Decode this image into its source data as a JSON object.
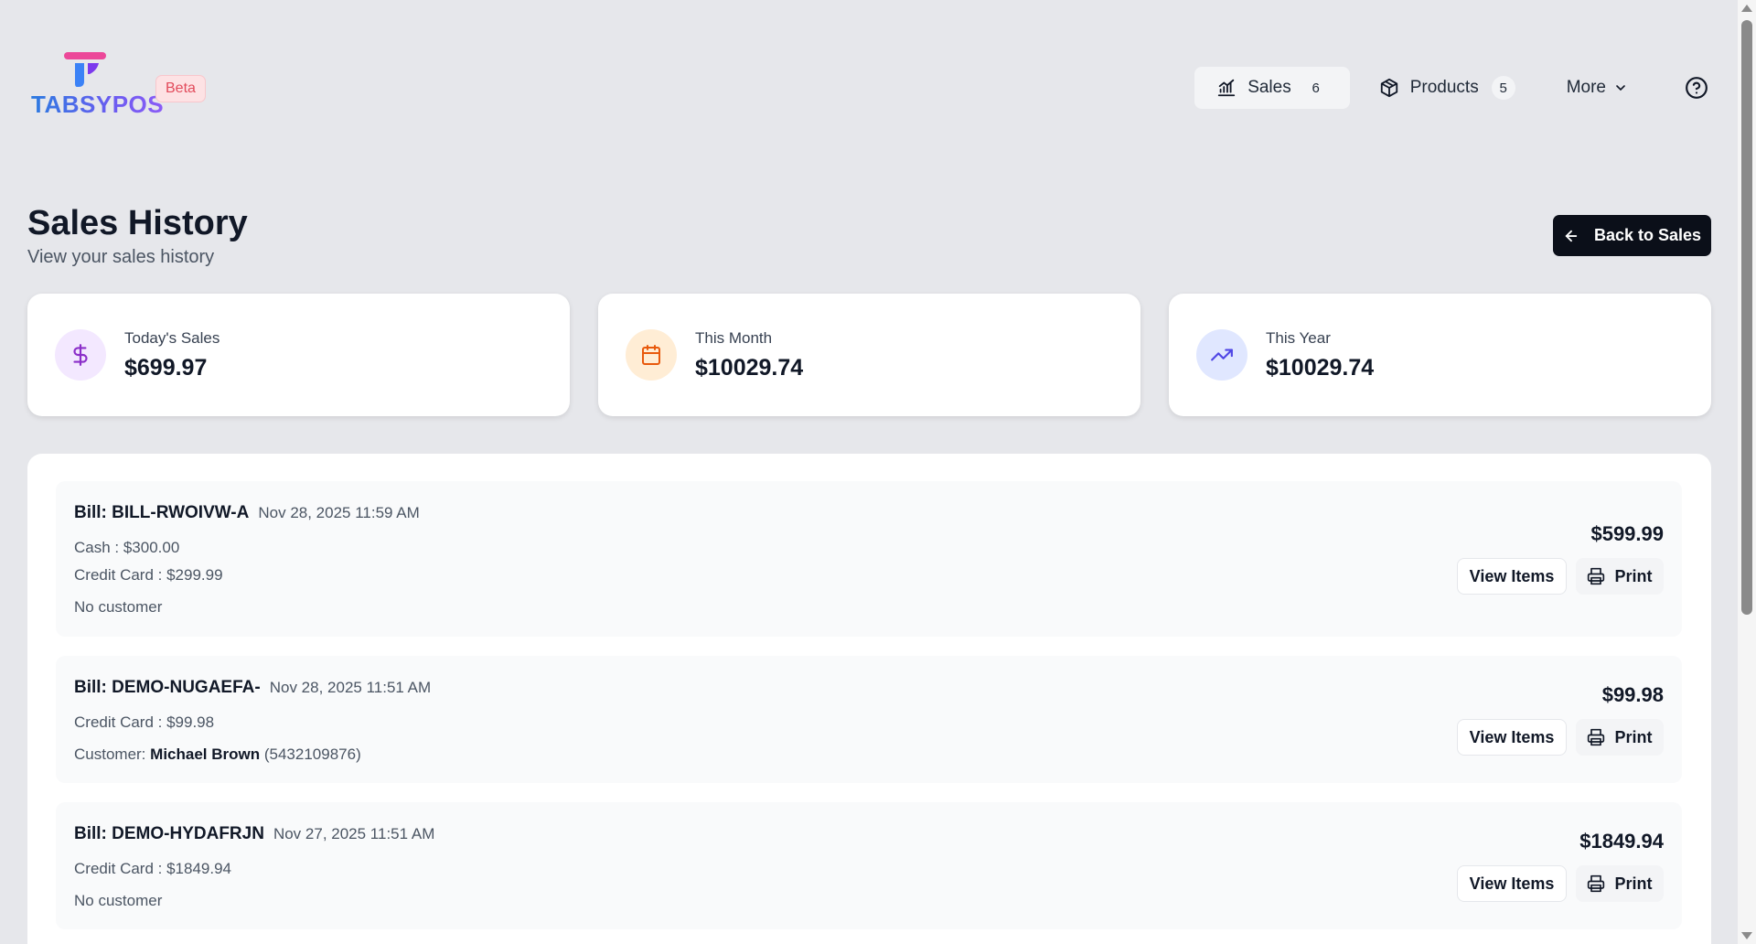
{
  "app": {
    "logo_text": "TABSYPOS",
    "beta_label": "Beta"
  },
  "nav": {
    "sales_label": "Sales",
    "sales_count": "6",
    "products_label": "Products",
    "products_count": "5",
    "more_label": "More"
  },
  "header": {
    "title": "Sales History",
    "subtitle": "View your sales history",
    "back_label": "Back to Sales"
  },
  "stats": [
    {
      "label": "Today's Sales",
      "value": "$699.97",
      "icon": "dollar-icon",
      "color": "#8b2fc9",
      "bg": "#f3e8ff"
    },
    {
      "label": "This Month",
      "value": "$10029.74",
      "icon": "calendar-icon",
      "color": "#e8590c",
      "bg": "#ffedd5"
    },
    {
      "label": "This Year",
      "value": "$10029.74",
      "icon": "trending-up-icon",
      "color": "#4f46e5",
      "bg": "#e0e7ff"
    }
  ],
  "sales": [
    {
      "bill": "Bill: BILL-RWOIVW-A",
      "date": "Nov 28, 2025 11:59 AM",
      "payments": [
        "Cash : $300.00",
        "Credit Card : $299.99"
      ],
      "customer_text": "No customer",
      "amount": "$599.99"
    },
    {
      "bill": "Bill: DEMO-NUGAEFA-",
      "date": "Nov 28, 2025 11:51 AM",
      "payments": [
        "Credit Card : $99.98"
      ],
      "customer_prefix": "Customer:",
      "customer_name": "Michael Brown",
      "customer_phone": "(5432109876)",
      "amount": "$99.98"
    },
    {
      "bill": "Bill: DEMO-HYDAFRJN",
      "date": "Nov 27, 2025 11:51 AM",
      "payments": [
        "Credit Card : $1849.94"
      ],
      "customer_text": "No customer",
      "amount": "$1849.94"
    }
  ],
  "actions": {
    "view_items": "View Items",
    "print": "Print"
  }
}
